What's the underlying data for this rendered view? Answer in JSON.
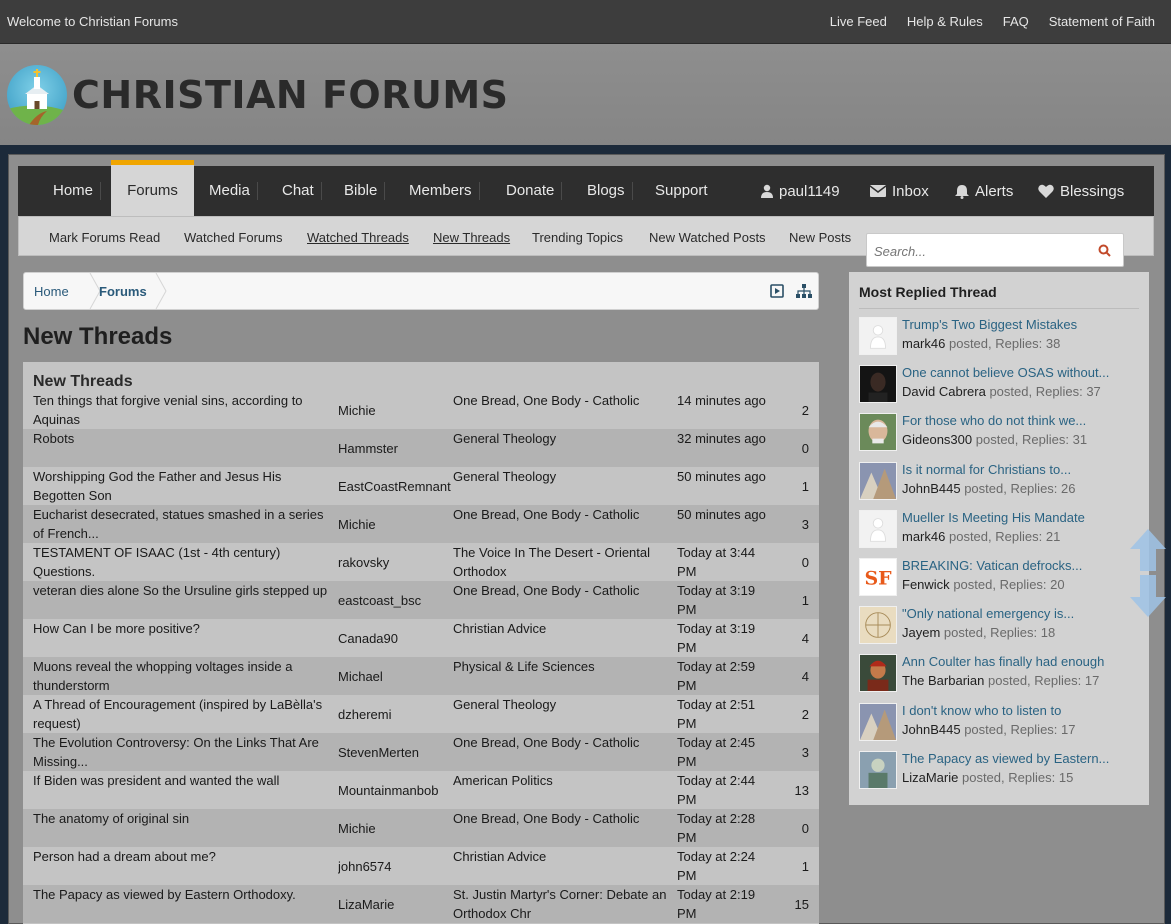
{
  "topbar": {
    "welcome": "Welcome to Christian Forums",
    "links": [
      "Live Feed",
      "Help & Rules",
      "FAQ",
      "Statement of Faith"
    ]
  },
  "header": {
    "site_title": "CHRISTIAN FORUMS"
  },
  "nav": {
    "items": [
      "Home",
      "Forums",
      "Media",
      "Chat",
      "Bible",
      "Members",
      "Donate",
      "Blogs",
      "Support"
    ],
    "active": "Forums",
    "user": "paul1149",
    "inbox": "Inbox",
    "alerts": "Alerts",
    "blessings": "Blessings"
  },
  "subnav": {
    "items": [
      "Mark Forums Read",
      "Watched Forums",
      "Watched Threads",
      "New Threads",
      "Trending Topics",
      "New Watched Posts",
      "New Posts"
    ],
    "search_placeholder": "Search..."
  },
  "breadcrumb": {
    "home": "Home",
    "forums": "Forums"
  },
  "page_title": "New Threads",
  "threads": {
    "heading": "New Threads",
    "rows": [
      {
        "title": "Ten things that forgive venial sins, according to Aquinas",
        "user": "Michie",
        "forum": "One Bread, One Body - Catholic",
        "time": "14 minutes ago",
        "replies": "2"
      },
      {
        "title": "Robots",
        "user": "Hammster",
        "forum": "General Theology",
        "time": "32 minutes ago",
        "replies": "0"
      },
      {
        "title": "Worshipping God the Father and Jesus His Begotten Son",
        "user": "EastCoastRemnant",
        "forum": "General Theology",
        "time": "50 minutes ago",
        "replies": "1"
      },
      {
        "title": "Eucharist desecrated, statues smashed in a series of French...",
        "user": "Michie",
        "forum": "One Bread, One Body - Catholic",
        "time": "50 minutes ago",
        "replies": "3"
      },
      {
        "title": "TESTAMENT OF ISAAC (1st - 4th century) Questions.",
        "user": "rakovsky",
        "forum": "The Voice In The Desert - Oriental Orthodox",
        "time": "Today at 3:44 PM",
        "replies": "0"
      },
      {
        "title": "veteran dies alone So the Ursuline girls stepped up",
        "user": "eastcoast_bsc",
        "forum": "One Bread, One Body - Catholic",
        "time": "Today at 3:19 PM",
        "replies": "1"
      },
      {
        "title": "How Can I be more positive?",
        "user": "Canada90",
        "forum": "Christian Advice",
        "time": "Today at 3:19 PM",
        "replies": "4"
      },
      {
        "title": "Muons reveal the whopping voltages inside a thunderstorm",
        "user": "Michael",
        "forum": "Physical & Life Sciences",
        "time": "Today at 2:59 PM",
        "replies": "4"
      },
      {
        "title": "A Thread of Encouragement (inspired by LaBèlla's request)",
        "user": "dzheremi",
        "forum": "General Theology",
        "time": "Today at 2:51 PM",
        "replies": "2"
      },
      {
        "title": "The Evolution Controversy: On the Links That Are Missing...",
        "user": "StevenMerten",
        "forum": "One Bread, One Body - Catholic",
        "time": "Today at 2:45 PM",
        "replies": "3"
      },
      {
        "title": "If Biden was president and wanted the wall",
        "user": "Mountainmanbob",
        "forum": "American Politics",
        "time": "Today at 2:44 PM",
        "replies": "13"
      },
      {
        "title": "The anatomy of original sin",
        "user": "Michie",
        "forum": "One Bread, One Body - Catholic",
        "time": "Today at 2:28 PM",
        "replies": "0"
      },
      {
        "title": "Person had a dream about me?",
        "user": "john6574",
        "forum": "Christian Advice",
        "time": "Today at 2:24 PM",
        "replies": "1"
      },
      {
        "title": "The Papacy as viewed by Eastern Orthodoxy.",
        "user": "LizaMarie",
        "forum": "St. Justin Martyr's Corner: Debate an Orthodox Chr",
        "time": "Today at 2:19 PM",
        "replies": "15"
      }
    ]
  },
  "sidebar": {
    "title": "Most Replied Thread",
    "posted_word": "posted, Replies:",
    "items": [
      {
        "title": "Trump's Two Biggest Mistakes",
        "user": "mark46",
        "replies": "38",
        "avatar": "default-avatar-icon"
      },
      {
        "title": "One cannot believe OSAS without...",
        "user": "David Cabrera",
        "replies": "37",
        "avatar": "dark-portrait-avatar"
      },
      {
        "title": "For those who do not think we...",
        "user": "Gideons300",
        "replies": "31",
        "avatar": "man-portrait-avatar"
      },
      {
        "title": "Is it normal for Christians to...",
        "user": "JohnB445",
        "replies": "26",
        "avatar": "painting-avatar"
      },
      {
        "title": "Mueller Is Meeting His Mandate",
        "user": "mark46",
        "replies": "21",
        "avatar": "default-avatar-icon"
      },
      {
        "title": "BREAKING: Vatican defrocks...",
        "user": "Fenwick",
        "replies": "20",
        "avatar": "sf-logo-avatar"
      },
      {
        "title": "\"Only national emergency is...",
        "user": "Jayem",
        "replies": "18",
        "avatar": "vitruvian-avatar"
      },
      {
        "title": "Ann Coulter has finally had enough",
        "user": "The Barbarian",
        "replies": "17",
        "avatar": "warrior-avatar"
      },
      {
        "title": "I don't know who to listen to",
        "user": "JohnB445",
        "replies": "17",
        "avatar": "painting-avatar"
      },
      {
        "title": "The Papacy as viewed by Eastern...",
        "user": "LizaMarie",
        "replies": "15",
        "avatar": "icon-art-avatar"
      }
    ]
  },
  "colors": {
    "accent": "#f0a500",
    "link": "#2a6383",
    "nav_bg": "#2e2e2e",
    "topbar_bg": "#3d3d3d"
  }
}
